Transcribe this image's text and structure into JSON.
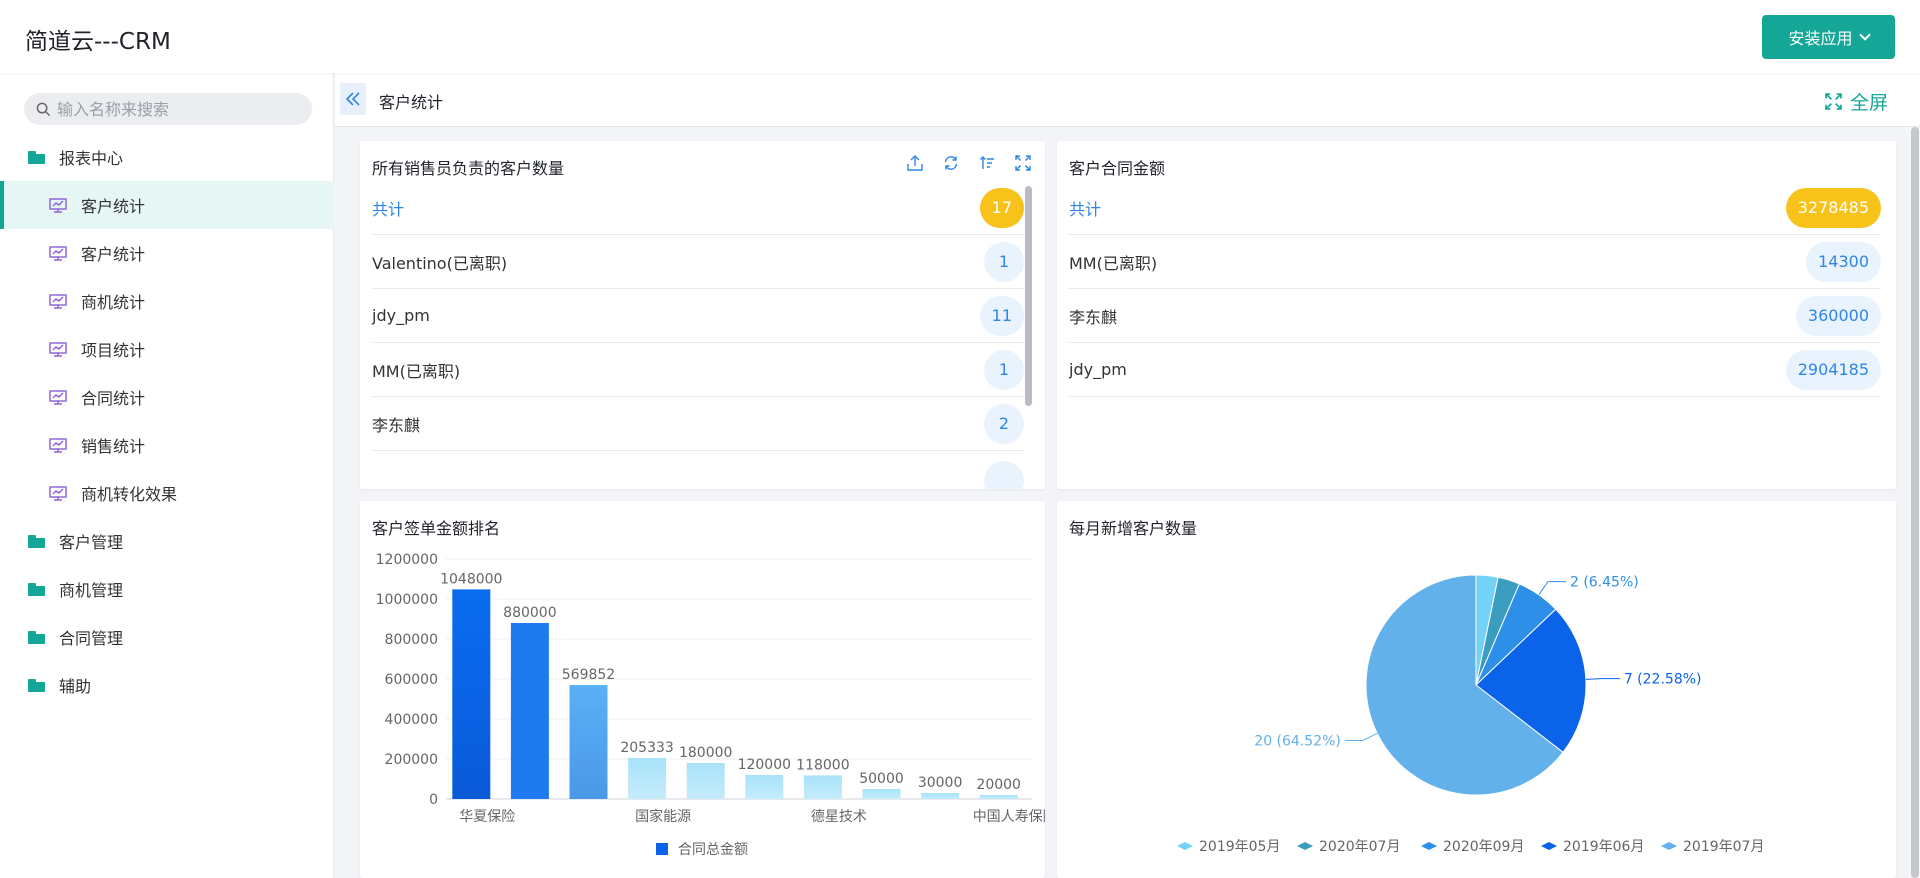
{
  "app": {
    "title": "简道云---CRM",
    "install_label": "安装应用"
  },
  "sidebar": {
    "search_placeholder": "输入名称来搜索",
    "items": [
      {
        "label": "报表中心",
        "kind": "folder"
      },
      {
        "label": "客户统计",
        "kind": "report",
        "active": true
      },
      {
        "label": "客户统计",
        "kind": "report"
      },
      {
        "label": "商机统计",
        "kind": "report"
      },
      {
        "label": "项目统计",
        "kind": "report"
      },
      {
        "label": "合同统计",
        "kind": "report"
      },
      {
        "label": "销售统计",
        "kind": "report"
      },
      {
        "label": "商机转化效果",
        "kind": "report"
      },
      {
        "label": "客户管理",
        "kind": "folder"
      },
      {
        "label": "商机管理",
        "kind": "folder"
      },
      {
        "label": "合同管理",
        "kind": "folder"
      },
      {
        "label": "辅助",
        "kind": "folder"
      }
    ]
  },
  "header": {
    "breadcrumb": "客户统计",
    "fullscreen_label": "全屏"
  },
  "panels": {
    "customer_count": {
      "title": "所有销售员负责的客户数量",
      "total_label": "共计",
      "total_value": "17",
      "rows": [
        {
          "name": "Valentino(已离职)",
          "value": "1"
        },
        {
          "name": "jdy_pm",
          "value": "11"
        },
        {
          "name": "MM(已离职)",
          "value": "1"
        },
        {
          "name": "李东麒",
          "value": "2"
        }
      ]
    },
    "contract_amount": {
      "title": "客户合同金额",
      "total_label": "共计",
      "total_value": "3278485",
      "rows": [
        {
          "name": "MM(已离职)",
          "value": "14300"
        },
        {
          "name": "李东麒",
          "value": "360000"
        },
        {
          "name": "jdy_pm",
          "value": "2904185"
        }
      ]
    },
    "ranking": {
      "title": "客户签单金额排名"
    },
    "monthly": {
      "title": "每月新增客户数量"
    }
  },
  "colors": {
    "accent": "#14a697",
    "total_badge": "#f7c31a",
    "link_blue": "#2f86e6"
  },
  "chart_data": [
    {
      "type": "bar",
      "title": "客户签单金额排名",
      "categories": [
        "华夏保险",
        "",
        "",
        "国家能源",
        "",
        "",
        "德星技术",
        "",
        "",
        "中国人寿保险"
      ],
      "series": [
        {
          "name": "合同总金额",
          "values": [
            1048000,
            880000,
            569852,
            205333,
            180000,
            120000,
            118000,
            50000,
            30000,
            20000
          ]
        }
      ],
      "ylim": [
        0,
        1200000
      ],
      "yticks": [
        "0",
        "200000",
        "400000",
        "600000",
        "800000",
        "1000000",
        "1200000"
      ],
      "legend": "bottom",
      "grid": true
    },
    {
      "type": "pie",
      "title": "每月新增客户数量",
      "slices": [
        {
          "name": "2019年05月",
          "value": 1,
          "color": "#73d2f5"
        },
        {
          "name": "2020年07月",
          "value": 1,
          "color": "#3a9dbf"
        },
        {
          "name": "2020年09月",
          "value": 2,
          "color": "#2e8fe8",
          "label": "2 (6.45%)"
        },
        {
          "name": "2019年06月",
          "value": 7,
          "color": "#0a63e9",
          "label": "7 (22.58%)"
        },
        {
          "name": "2019年07月",
          "value": 20,
          "color": "#63b1ea",
          "label": "20 (64.52%)"
        }
      ],
      "legend": "bottom"
    }
  ]
}
